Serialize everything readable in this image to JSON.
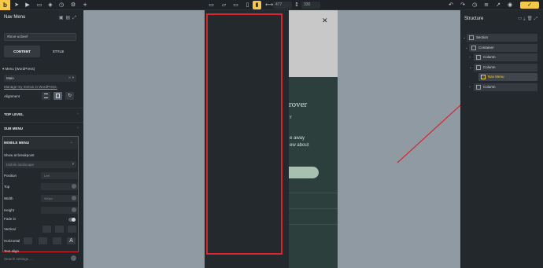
{
  "topbar": {
    "logo": "b",
    "left_icons": [
      "cursor-icon",
      "play-icon",
      "file-icon",
      "layers-icon",
      "clock-icon",
      "settings-icon",
      "plus-icon"
    ],
    "devices": [
      "desktop-icon",
      "laptop-icon",
      "tablet-landscape-icon",
      "tablet-portrait-icon",
      "mobile-landscape-icon",
      "mobile-portrait-icon"
    ],
    "width_value": "477",
    "height_value": "330",
    "right_icons": [
      "undo-icon",
      "redo-icon",
      "history-icon",
      "tree-icon",
      "external-icon",
      "eye-icon",
      "save-icon"
    ]
  },
  "left_panel": {
    "title": "Nav Menu",
    "class_input": "#brxe-ucbeef",
    "tabs": [
      "CONTENT",
      "STYLE"
    ],
    "menu_label": "Menu (WordPress)",
    "menu_value": "Main",
    "manage_link": "Manage my menus in WordPress.",
    "alignment_label": "Alignment",
    "sections": [
      "TOP LEVEL",
      "SUB MENU",
      "MOBILE MENU"
    ],
    "mobile_menu": {
      "show_at_breakpoint": "Show at breakpoint",
      "breakpoint_value": "Mobile landscape",
      "rows": [
        {
          "label": "Position",
          "value": "Left"
        },
        {
          "label": "Top",
          "value": ""
        },
        {
          "label": "Width",
          "value": "300px"
        },
        {
          "label": "Height",
          "value": ""
        }
      ],
      "fade_in": "Fade in",
      "vertical": "Vertical",
      "horizontal": "Horizontal",
      "text_align": "Text align"
    },
    "search_placeholder": "Search settings ..."
  },
  "canvas": {
    "hero_title": "rover",
    "hero_sub": "y",
    "hero_text": [
      "e away",
      "ew about"
    ]
  },
  "right_panel": {
    "title": "Structure",
    "tree": [
      {
        "label": "Section",
        "depth": 0
      },
      {
        "label": "Container",
        "depth": 1
      },
      {
        "label": "Column",
        "depth": 2
      },
      {
        "label": "Column",
        "depth": 2
      },
      {
        "label": "Nav Menu",
        "depth": 3,
        "selected": true
      },
      {
        "label": "Column",
        "depth": 2
      }
    ]
  },
  "colors": {
    "accent": "#f4c84a",
    "highlight_red": "#d8262c",
    "panel_bg": "#23282d",
    "canvas_bg": "#8f9aa3"
  }
}
